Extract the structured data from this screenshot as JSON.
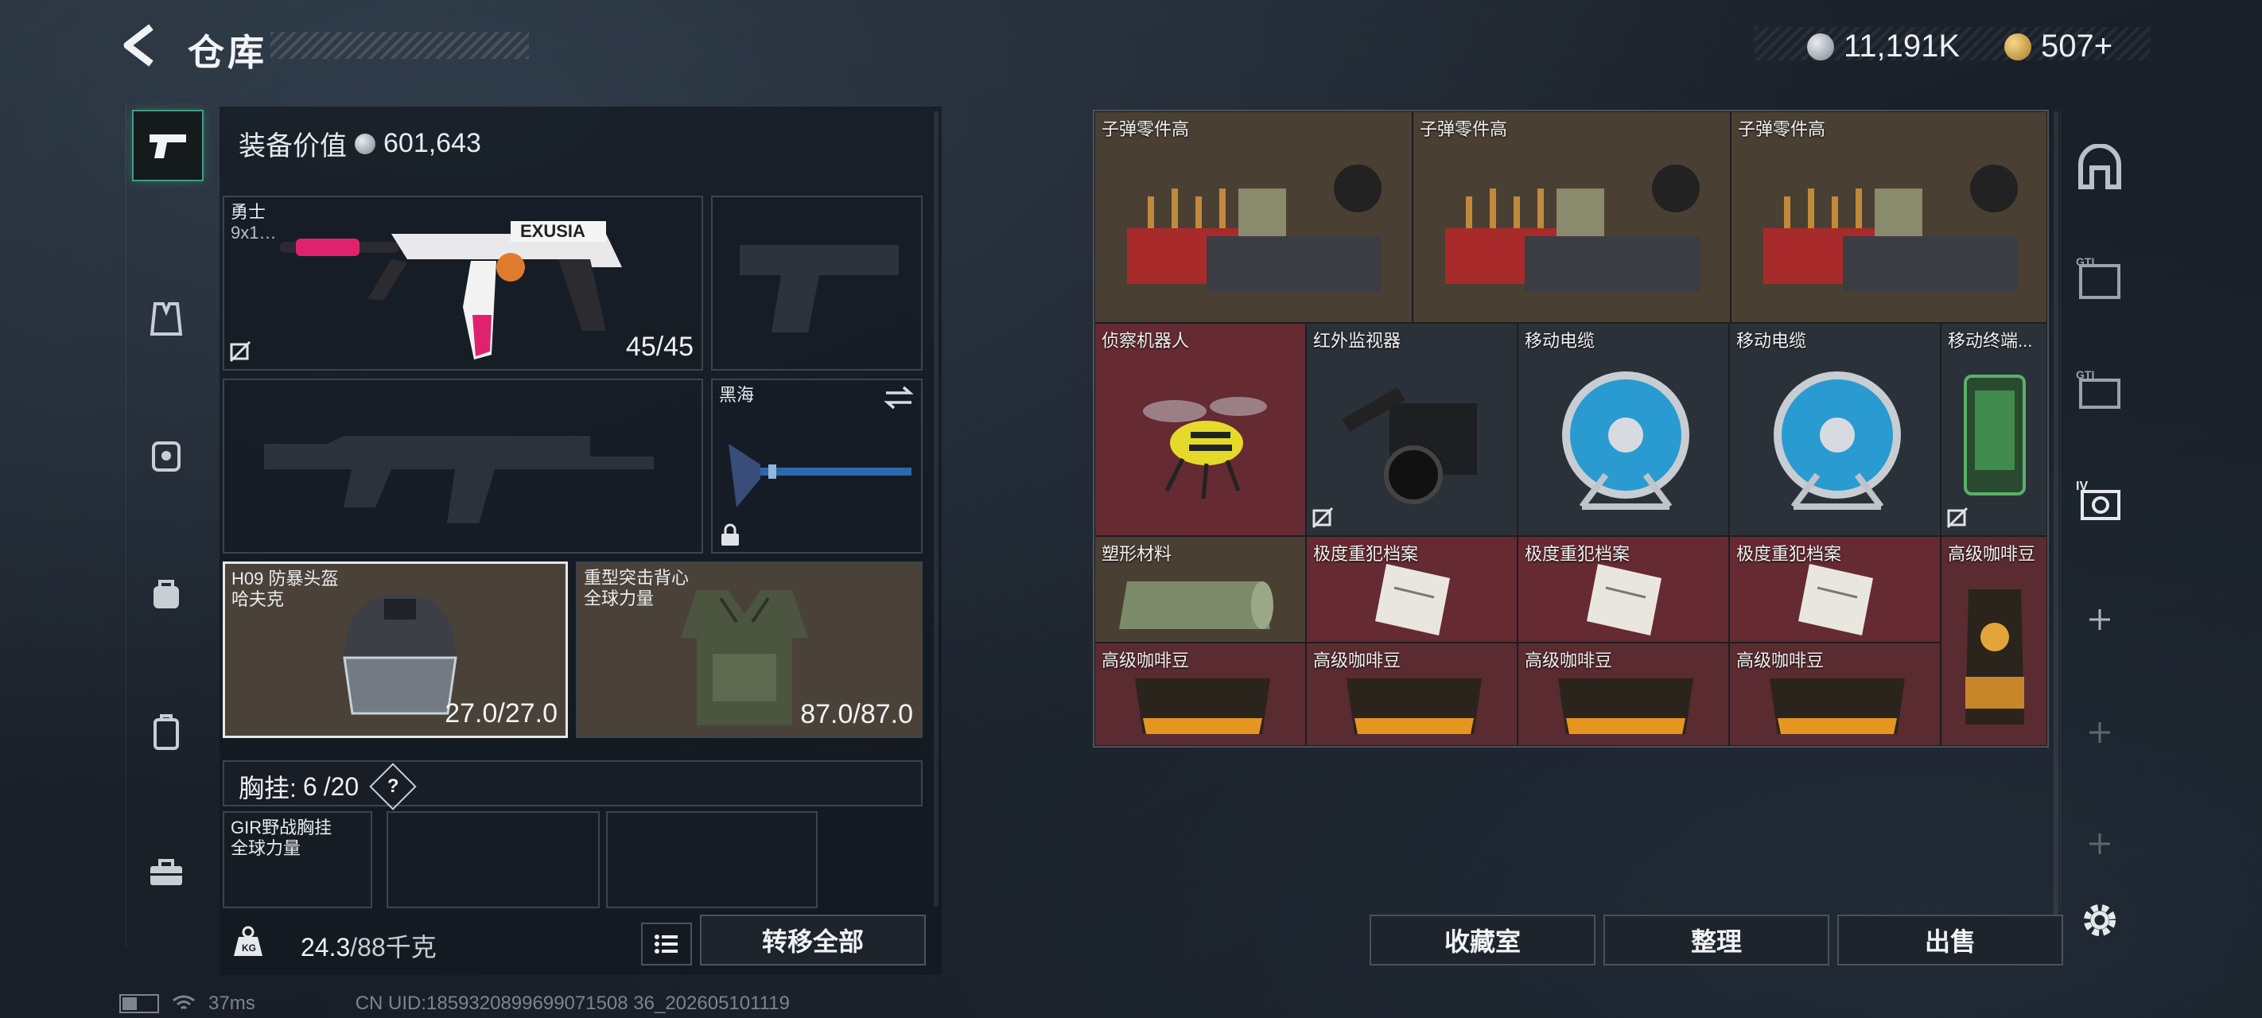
{
  "header": {
    "title": "仓库",
    "back_icon": "back-arrow-icon"
  },
  "currency": [
    {
      "icon": "silver-coin-icon",
      "value": "11,191K"
    },
    {
      "icon": "gold-coin-icon",
      "value": "507+"
    }
  ],
  "left_rail": [
    "pistol-icon",
    "vest-icon",
    "backpack-icon",
    "bag-icon",
    "case-icon",
    "toolbox-icon"
  ],
  "equipment": {
    "value_label": "装备价值",
    "value": "601,643",
    "primary": {
      "name": "勇士",
      "ammo": "9x1…",
      "durability": "45/45"
    },
    "melee": {
      "name": "黑海"
    },
    "helmet": {
      "name": "H09 防暴头盔",
      "maker": "哈夫克",
      "durability": "27.0/27.0"
    },
    "armor": {
      "name": "重型突击背心",
      "maker": "全球力量",
      "durability": "87.0/87.0"
    },
    "rig": {
      "label": "胸挂:",
      "used": "6",
      "total": "/20",
      "help": "?"
    },
    "rig_item": {
      "name": "GIR野战胸挂",
      "maker": "全球力量"
    },
    "weight": "24.3",
    "weight_total": "/88千克",
    "transfer_all": "转移全部"
  },
  "storage": {
    "rows": [
      [
        {
          "label": "子弹零件高"
        },
        {
          "label": "子弹零件高"
        },
        {
          "label": "子弹零件高"
        }
      ],
      [
        {
          "label": "侦察机器人"
        },
        {
          "label": "红外监视器"
        },
        {
          "label": "移动电缆"
        },
        {
          "label": "移动电缆"
        },
        {
          "label": "移动终端..."
        }
      ],
      [
        {
          "label": "塑形材料"
        },
        {
          "label": "极度重犯档案"
        },
        {
          "label": "极度重犯档案"
        },
        {
          "label": "极度重犯档案"
        },
        {
          "label": "高级咖啡豆"
        }
      ],
      [
        {
          "label": "高级咖啡豆"
        },
        {
          "label": "高级咖啡豆"
        },
        {
          "label": "高级咖啡豆"
        },
        {
          "label": "高级咖啡豆"
        }
      ]
    ]
  },
  "actions": {
    "collection": "收藏室",
    "sort": "整理",
    "sell": "出售"
  },
  "right_rail": [
    "safe-icon",
    "gti-a-icon",
    "gti-b-icon",
    "iv-icon",
    "plus-icon",
    "plus-icon",
    "plus-icon",
    "settings-icon"
  ],
  "footer": {
    "ping": "37ms",
    "uid": "CN UID:1859320899699071508 36_202605101119"
  }
}
